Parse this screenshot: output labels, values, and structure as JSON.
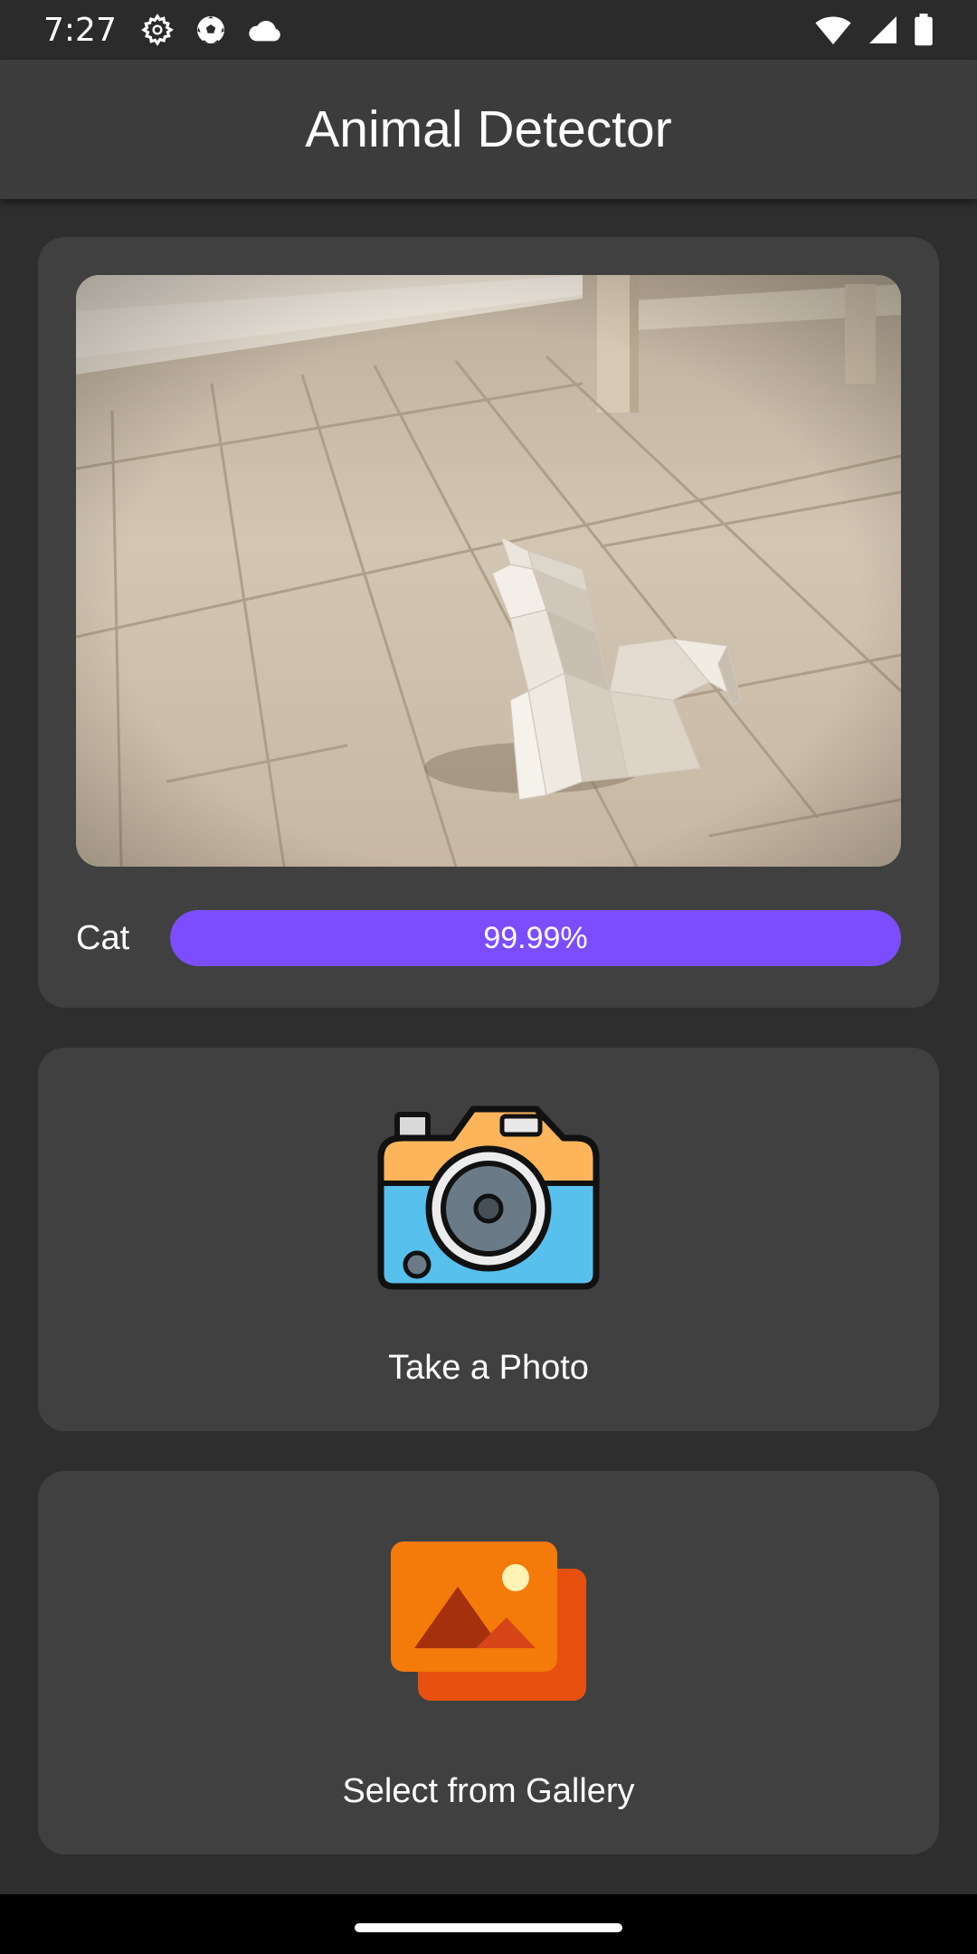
{
  "status_bar": {
    "time": "7:27",
    "left_icons": [
      "settings-icon",
      "soccer-ball-icon",
      "cloud-icon"
    ],
    "right_icons": [
      "wifi-icon",
      "signal-icon",
      "battery-icon"
    ]
  },
  "app_bar": {
    "title": "Animal Detector"
  },
  "result": {
    "photo_icon": "cat-photo",
    "label": "Cat",
    "confidence": 0.9999,
    "confidence_text": "99.99%",
    "bar_color": "#7c4dff"
  },
  "camera_action": {
    "label": "Take a Photo",
    "icon": "camera-icon"
  },
  "gallery_action": {
    "label": "Select from Gallery",
    "icon": "gallery-icon"
  }
}
